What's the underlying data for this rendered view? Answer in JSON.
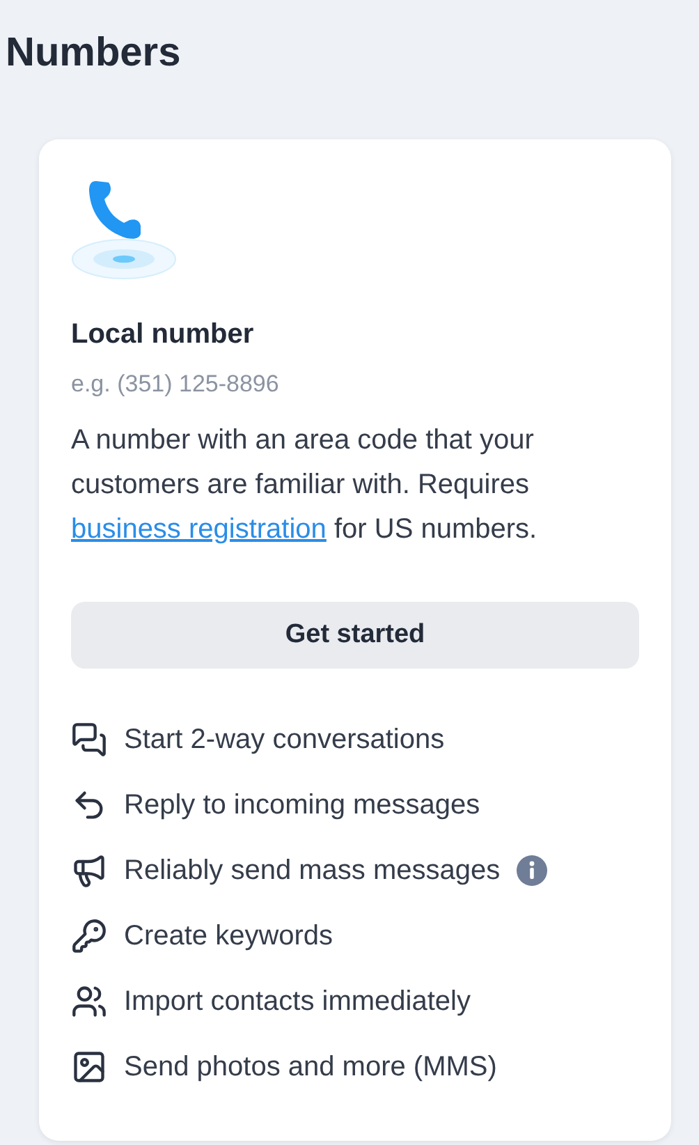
{
  "page_title": "Numbers",
  "card": {
    "title": "Local number",
    "example": "e.g. (351) 125-8896",
    "description": {
      "before": "A number with an area code that your customers are familiar with. Requires ",
      "link": "business registration",
      "after": " for US numbers."
    },
    "button": "Get started",
    "features": [
      {
        "kind": "chat",
        "label": "Start 2-way conversations",
        "info": false
      },
      {
        "kind": "reply",
        "label": "Reply to incoming messages",
        "info": false
      },
      {
        "kind": "megaphone",
        "label": "Reliably send mass messages",
        "info": true
      },
      {
        "kind": "key",
        "label": "Create keywords",
        "info": false
      },
      {
        "kind": "contacts",
        "label": "Import contacts immediately",
        "info": false
      },
      {
        "kind": "image",
        "label": "Send photos and more (MMS)",
        "info": false
      }
    ]
  }
}
